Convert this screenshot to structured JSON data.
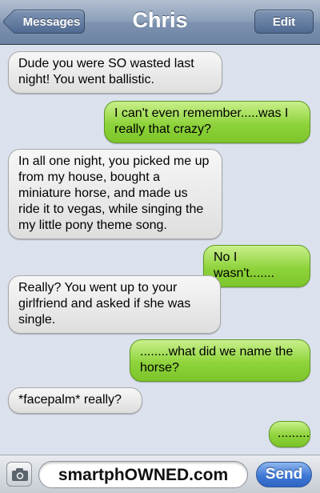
{
  "header": {
    "back_label": "Messages",
    "title": "Chris",
    "edit_label": "Edit"
  },
  "messages": [
    {
      "side": "in",
      "text": "Dude you were SO wasted last night! You went ballistic."
    },
    {
      "side": "out",
      "text": "I can't even remember.....was I really that crazy?"
    },
    {
      "side": "in",
      "text": "In all one night, you picked me up from my house, bought a miniature horse, and made us ride it to vegas, while singing the my little pony theme song."
    },
    {
      "side": "out",
      "text": "No I wasn't......."
    },
    {
      "side": "in",
      "text": "Really? You went up to your girlfriend and asked if she was single."
    },
    {
      "side": "out",
      "text": "........what did we name the horse?"
    },
    {
      "side": "in",
      "text": "*facepalm* really?"
    },
    {
      "side": "out",
      "text": "........."
    }
  ],
  "input": {
    "value": "smartphOWNED.com",
    "send_label": "Send",
    "camera_icon": "camera-icon"
  },
  "colors": {
    "outgoing_bubble": "#8ed33b",
    "incoming_bubble": "#e8e8e8",
    "send_button": "#3f78d6",
    "background": "#dbe2ed"
  }
}
